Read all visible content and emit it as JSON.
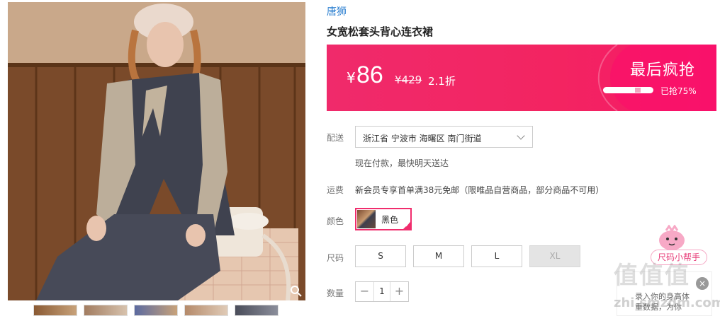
{
  "product": {
    "brand": "唐狮",
    "title": "女宽松套头背心连衣裙"
  },
  "price": {
    "currency": "¥",
    "current": "86",
    "original": "¥429",
    "discount": "2.1折",
    "flash_label": "最后疯抢",
    "sold_text": "已抢75%",
    "sold_fraction": 0.75,
    "accent_color": "#f02a6b"
  },
  "shipping": {
    "label": "配送",
    "address": "浙江省 宁波市 海曙区 南门街道",
    "note": "现在付款，最快明天送达"
  },
  "fee": {
    "label": "运费",
    "text": "新会员专享首单满38元免邮（限唯品自营商品，部分商品不可用）"
  },
  "color": {
    "label": "颜色",
    "selected": "黑色"
  },
  "size": {
    "label": "尺码",
    "options": [
      {
        "text": "S",
        "disabled": false
      },
      {
        "text": "M",
        "disabled": false
      },
      {
        "text": "L",
        "disabled": false
      },
      {
        "text": "XL",
        "disabled": true
      }
    ]
  },
  "quantity": {
    "label": "数量",
    "minus": "−",
    "value": "1",
    "plus": "+"
  },
  "helper": {
    "title": "尺码小帮手",
    "line1": "录入你的身高体",
    "line2": "重数据，为你"
  },
  "watermark": {
    "main": "值值值",
    "sub": "zhi.smzdm.com"
  },
  "icons": [
    "zoom-icon",
    "chevron-down-icon",
    "check-icon",
    "close-icon"
  ]
}
